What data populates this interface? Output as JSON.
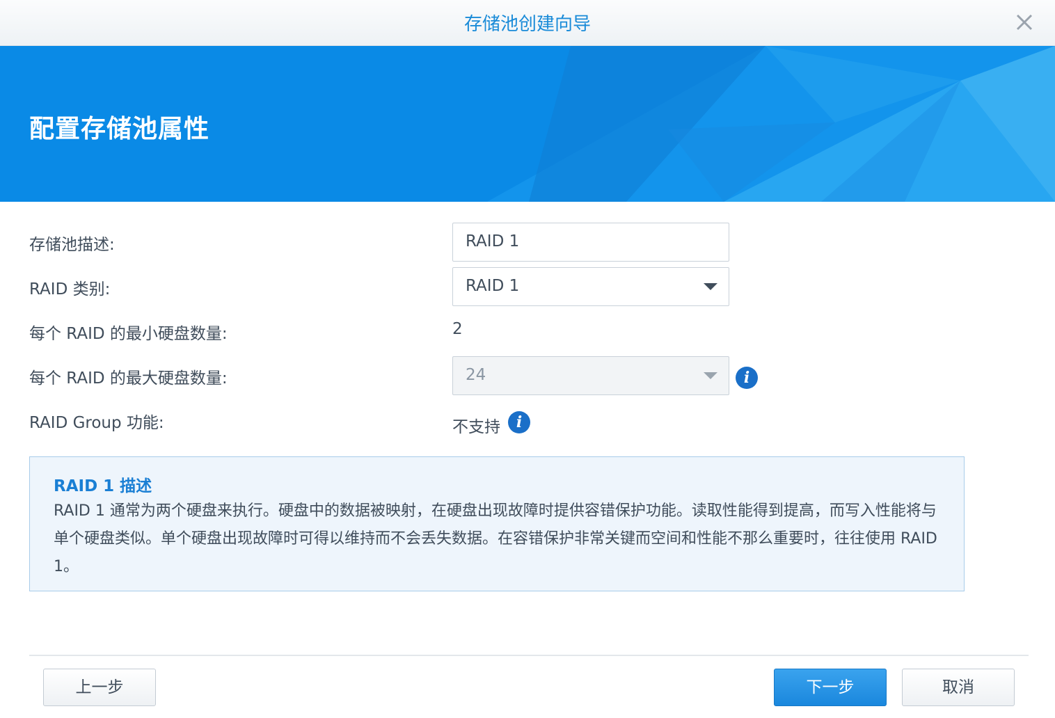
{
  "window": {
    "title": "存储池创建向导",
    "close_icon": "close-icon"
  },
  "banner": {
    "heading": "配置存储池属性"
  },
  "form": {
    "description": {
      "label": "存储池描述:",
      "value": "RAID 1"
    },
    "raid_type": {
      "label": "RAID 类别:",
      "value": "RAID 1"
    },
    "min_disks": {
      "label": "每个 RAID 的最小硬盘数量:",
      "value": "2"
    },
    "max_disks": {
      "label": "每个 RAID 的最大硬盘数量:",
      "value": "24"
    },
    "raid_group": {
      "label": "RAID Group 功能:",
      "value": "不支持"
    }
  },
  "raid_description": {
    "title": "RAID 1 描述",
    "body": "RAID 1 通常为两个硬盘来执行。硬盘中的数据被映射，在硬盘出现故障时提供容错保护功能。读取性能得到提高，而写入性能将与单个硬盘类似。单个硬盘出现故障时可得以维持而不会丢失数据。在容错保护非常关键而空间和性能不那么重要时，往往使用 RAID 1。"
  },
  "footer": {
    "back_label": "上一步",
    "next_label": "下一步",
    "cancel_label": "取消"
  },
  "colors": {
    "accent": "#1a8bd8",
    "banner": "#0a8ae6",
    "info_icon": "#1a6fc8"
  }
}
